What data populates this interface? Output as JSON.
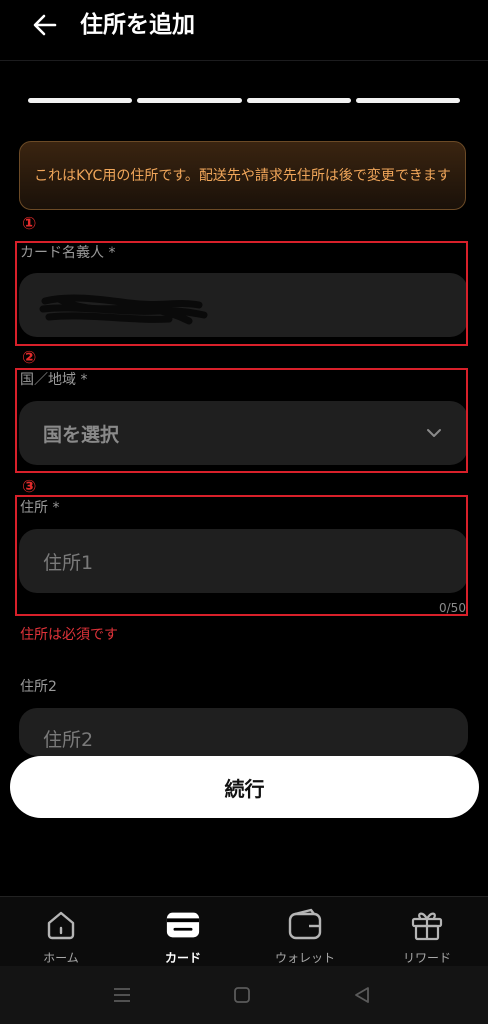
{
  "header": {
    "title": "住所を追加",
    "back_icon": "arrow-left-icon"
  },
  "progress": {
    "steps_total": 4,
    "steps_completed": 4
  },
  "notice": {
    "text": "これはKYC用の住所です。配送先や請求先住所は後で変更できます"
  },
  "annotations": {
    "marker1": "①",
    "marker2": "②",
    "marker3": "③"
  },
  "form": {
    "card_holder": {
      "label": "カード名義人 *"
    },
    "country": {
      "label": "国／地域 *",
      "value": "国を選択"
    },
    "address1": {
      "label": "住所 *",
      "placeholder": "住所1",
      "counter": "0/50",
      "error": "住所は必須です"
    },
    "address2": {
      "label": "住所2",
      "placeholder": "住所2"
    }
  },
  "continue_label": "続行",
  "tabs": [
    {
      "label": "ホーム",
      "icon": "home-icon",
      "active": false
    },
    {
      "label": "カード",
      "icon": "card-icon",
      "active": true
    },
    {
      "label": "ウォレット",
      "icon": "wallet-icon",
      "active": false
    },
    {
      "label": "リワード",
      "icon": "gift-icon",
      "active": false
    }
  ],
  "colors": {
    "accent_notice": "#f0a65a",
    "error": "#e0333a",
    "annotation_red": "#d8202a"
  }
}
